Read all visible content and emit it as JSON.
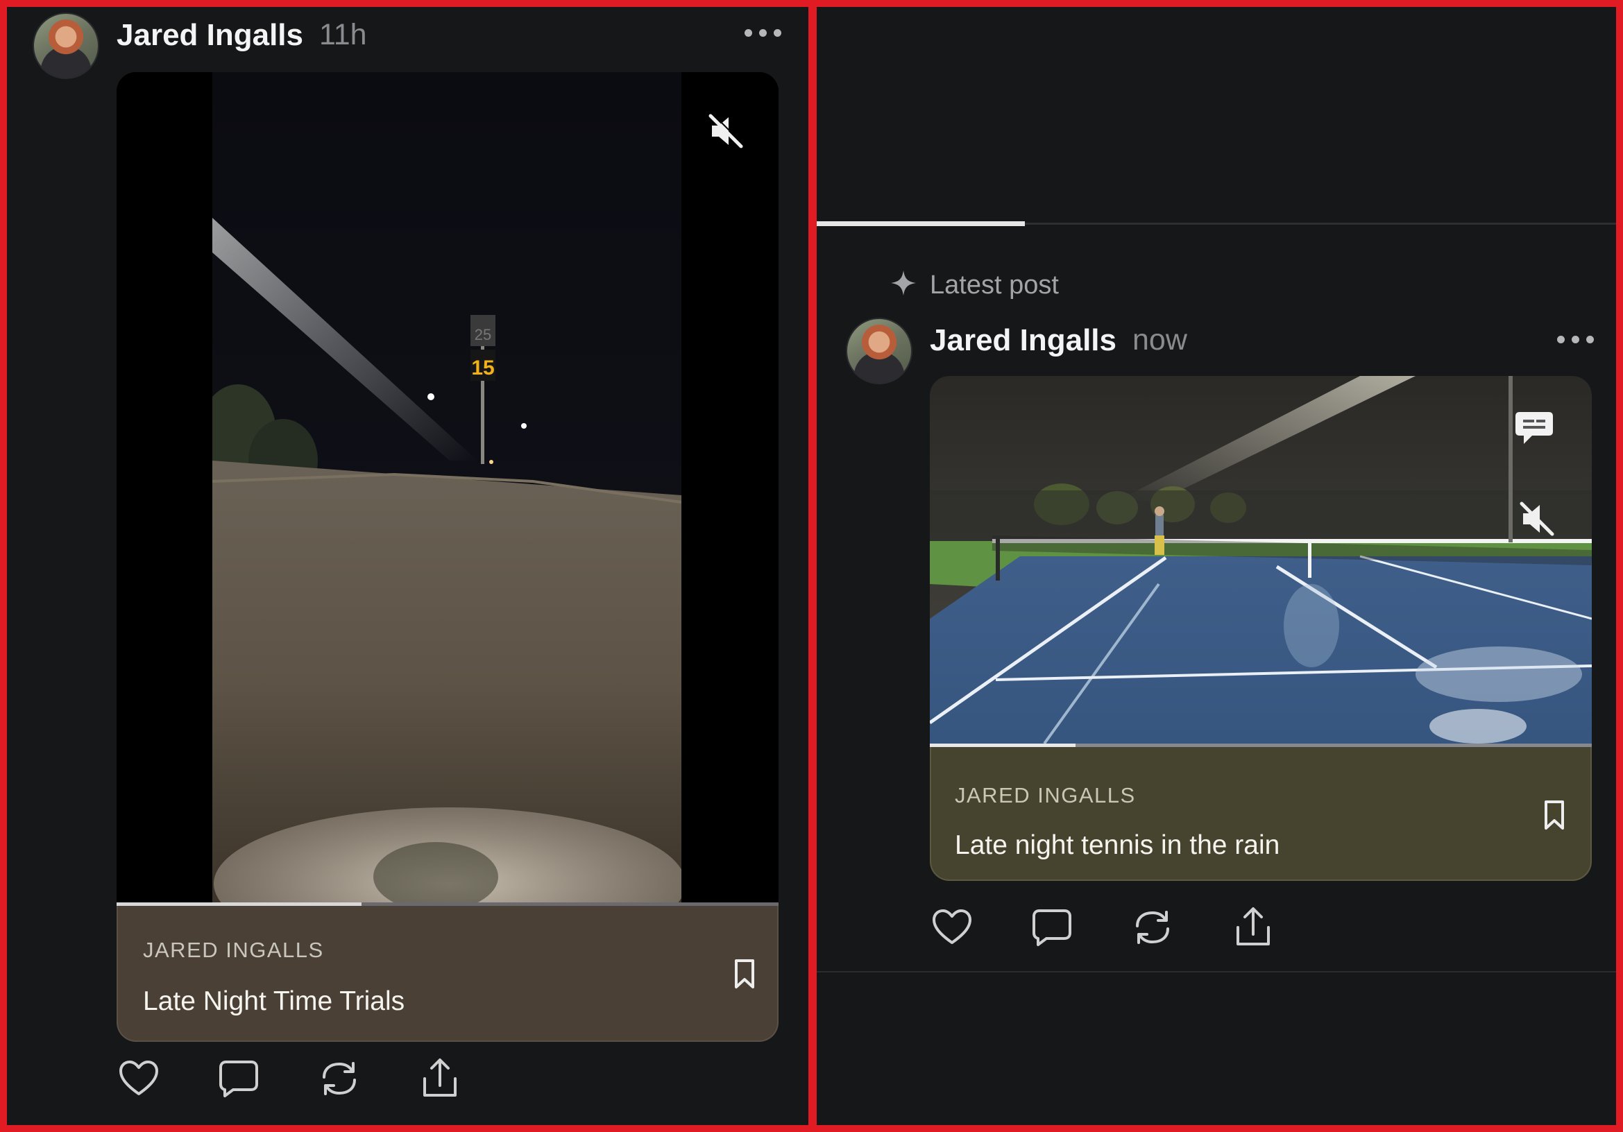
{
  "left_post": {
    "author": "Jared Ingalls",
    "time": "11h",
    "card": {
      "author_caps": "JARED INGALLS",
      "title": "Late Night Time Trials"
    },
    "video_progress": 0.37,
    "sign_number": "15",
    "sign_top_number": "25",
    "card_color": "#4a4036"
  },
  "right_post": {
    "section_label": "Latest post",
    "author": "Jared Ingalls",
    "time": "now",
    "card": {
      "author_caps": "JARED INGALLS",
      "title": "Late night tennis in the rain"
    },
    "video_progress": 0.22,
    "top_progress": 0.26,
    "card_color": "#46442e"
  },
  "icons": {
    "mute": "speaker-muted-icon",
    "captions": "captions-icon",
    "bookmark": "bookmark-icon",
    "like": "heart-icon",
    "reply": "comment-icon",
    "repost": "repost-icon",
    "share": "share-icon",
    "more": "more-dots-icon",
    "sparkle": "sparkle-icon"
  }
}
